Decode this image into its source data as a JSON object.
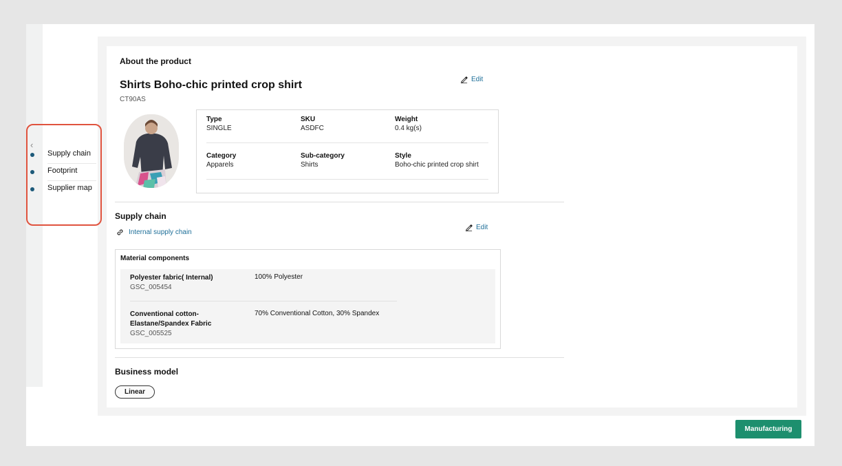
{
  "colors": {
    "accent_link": "#1d6e98",
    "nav_dot": "#1d5a7a",
    "highlight_border": "#e0533e",
    "primary_button": "#1d8f6e"
  },
  "side_nav": {
    "collapse_icon": "chevron-left-icon",
    "items": [
      {
        "label": "Supply chain"
      },
      {
        "label": "Footprint"
      },
      {
        "label": "Supplier map"
      }
    ]
  },
  "about": {
    "section_title": "About the product",
    "edit_label": "Edit",
    "edit_icon": "pencil-icon",
    "product_name": "Shirts Boho-chic printed crop shirt",
    "product_code": "CT90AS",
    "attributes": [
      {
        "key": "Type",
        "value": "SINGLE"
      },
      {
        "key": "SKU",
        "value": "ASDFC"
      },
      {
        "key": "Weight",
        "value": "0.4 kg(s)"
      },
      {
        "key": "Category",
        "value": "Apparels"
      },
      {
        "key": "Sub-category",
        "value": "Shirts"
      },
      {
        "key": "Style",
        "value": "Boho-chic printed crop shirt"
      }
    ]
  },
  "supply_chain": {
    "section_title": "Supply chain",
    "edit_label": "Edit",
    "link_icon": "link-icon",
    "link_label": "Internal supply chain",
    "materials_title": "Material components",
    "materials": [
      {
        "name_lines": [
          "Polyester fabric( Internal)"
        ],
        "code": "GSC_005454",
        "composition": "100% Polyester"
      },
      {
        "name_lines": [
          "Conventional cotton-",
          "Elastane/Spandex Fabric"
        ],
        "code": "GSC_005525",
        "composition": "70% Conventional Cotton, 30% Spandex"
      }
    ]
  },
  "business_model": {
    "section_title": "Business model",
    "value": "Linear"
  },
  "footer": {
    "primary_button": "Manufacturing"
  }
}
